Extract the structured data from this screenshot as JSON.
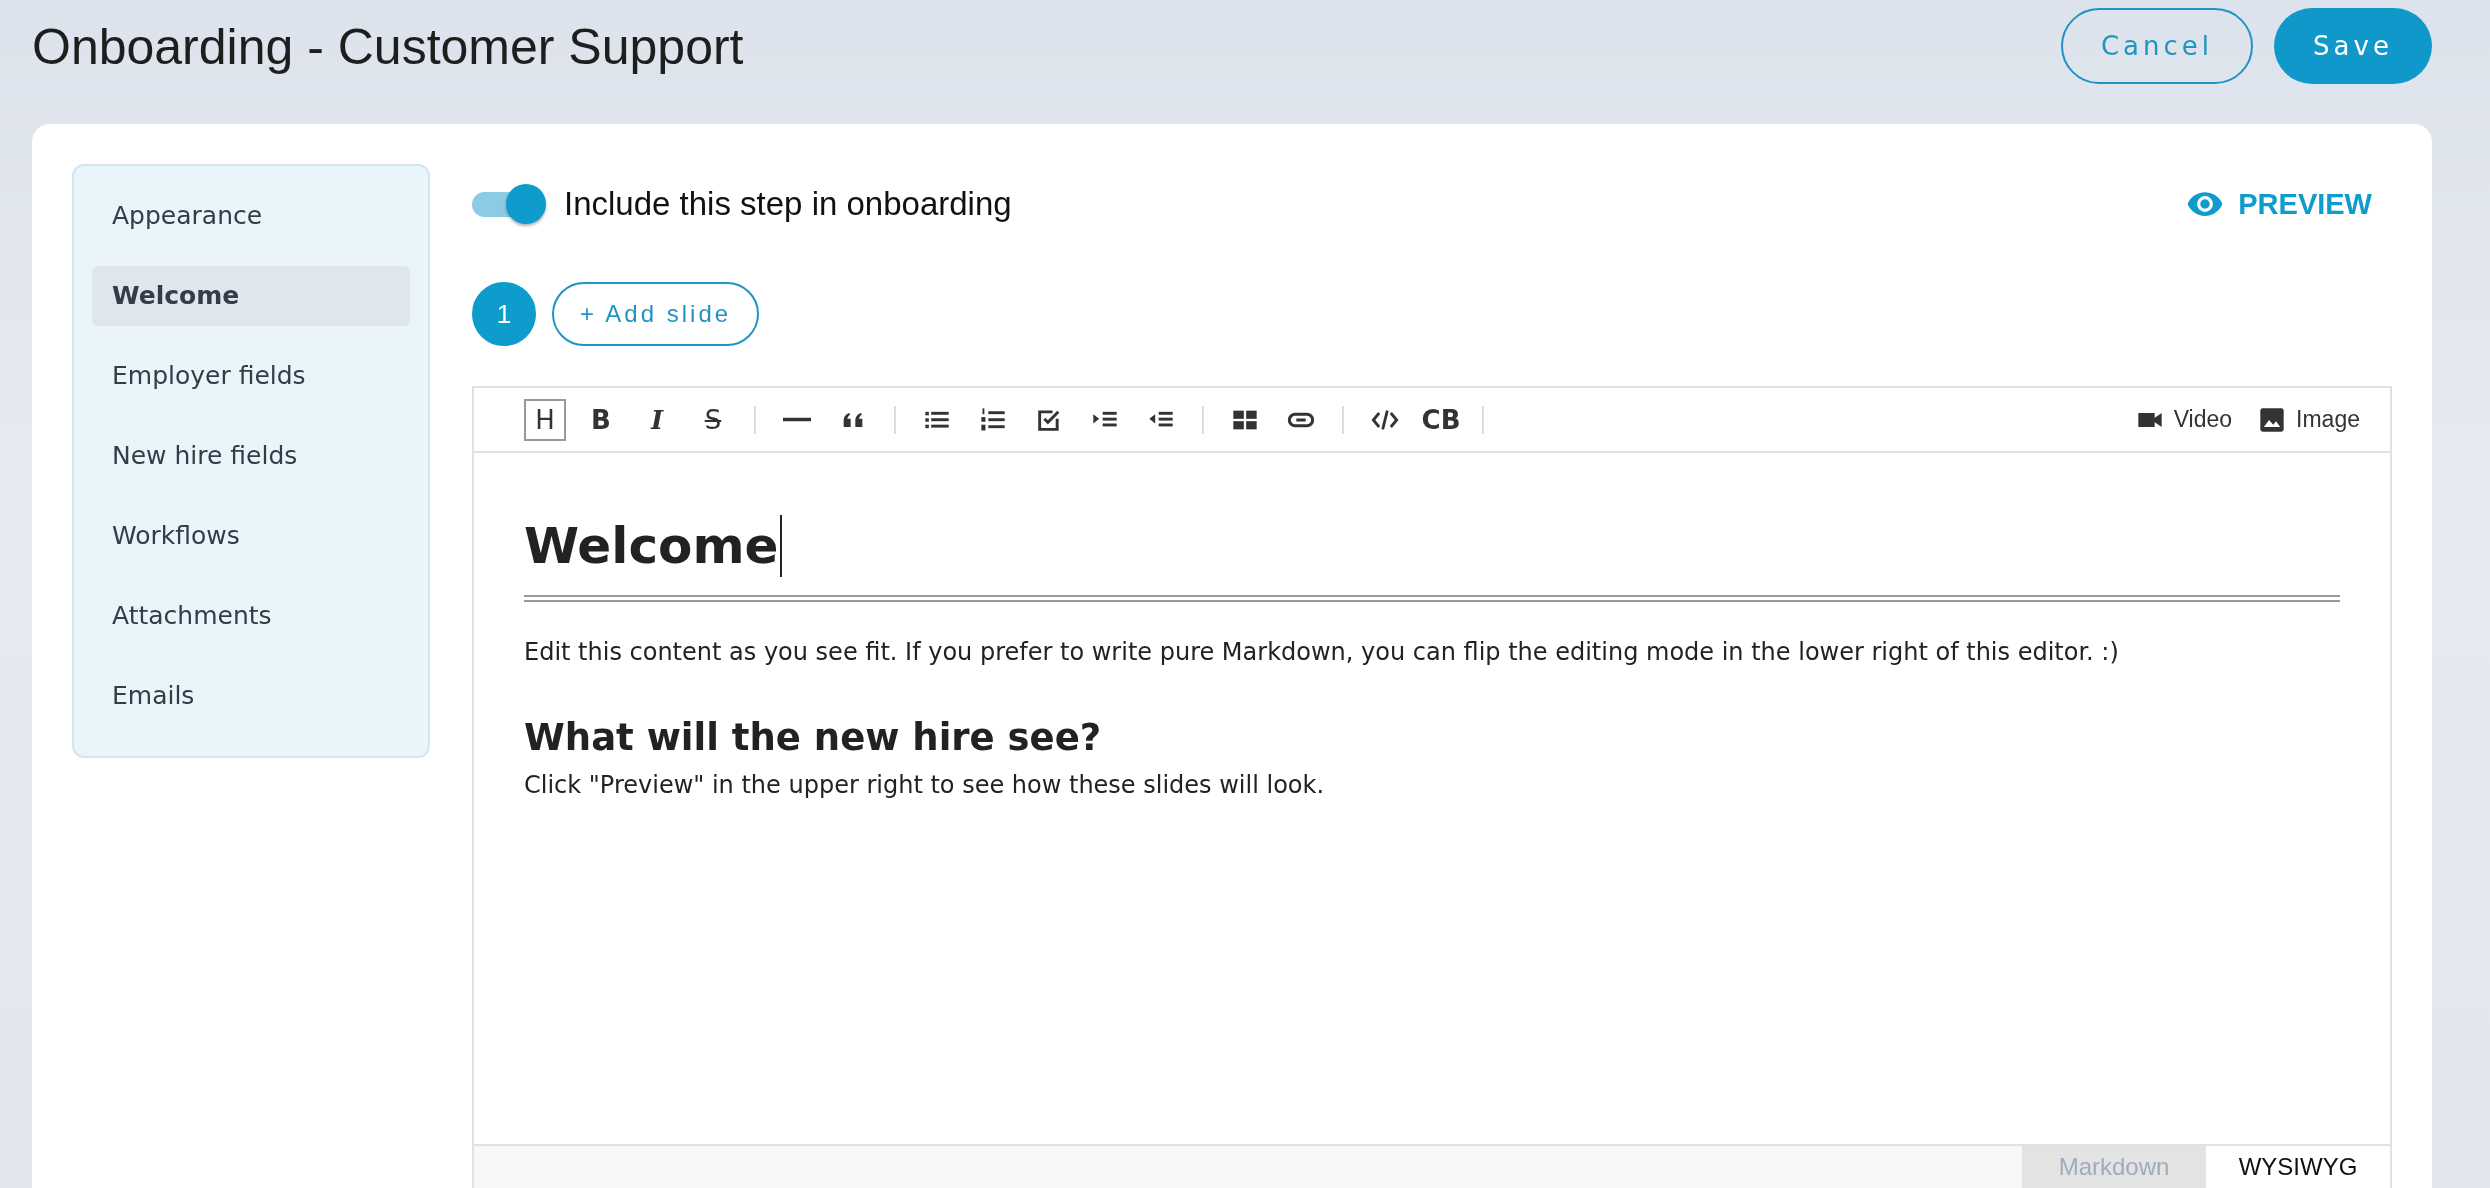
{
  "page": {
    "title": "Onboarding - Customer Support"
  },
  "actions": [
    {
      "label": "Cancel",
      "kind": "outline"
    },
    {
      "label": "Save",
      "kind": "primary"
    }
  ],
  "sidebar": {
    "items": [
      {
        "label": "Appearance",
        "selected": false
      },
      {
        "label": "Welcome",
        "selected": true
      },
      {
        "label": "Employer fields",
        "selected": false
      },
      {
        "label": "New hire fields",
        "selected": false
      },
      {
        "label": "Workflows",
        "selected": false
      },
      {
        "label": "Attachments",
        "selected": false
      },
      {
        "label": "Emails",
        "selected": false
      }
    ]
  },
  "include_toggle": {
    "label": "Include this step in onboarding",
    "on": true
  },
  "preview": {
    "label": "PREVIEW"
  },
  "slides": [
    {
      "label": "1",
      "selected": true
    }
  ],
  "add_slide": {
    "label": "+ Add slide"
  },
  "toolbar": {
    "tools": [
      {
        "kind": "heading",
        "label": "H",
        "selected": true
      },
      {
        "kind": "bold",
        "label": "B",
        "selected": false
      },
      {
        "kind": "italic",
        "label": "I",
        "selected": false
      },
      {
        "kind": "strike",
        "label": "S",
        "selected": false
      },
      {
        "kind": "separator"
      },
      {
        "kind": "rule",
        "selected": false
      },
      {
        "kind": "quote",
        "selected": false
      },
      {
        "kind": "separator"
      },
      {
        "kind": "bullets",
        "selected": false
      },
      {
        "kind": "numbers",
        "selected": false
      },
      {
        "kind": "checklist",
        "selected": false
      },
      {
        "kind": "indent",
        "selected": false
      },
      {
        "kind": "outdent",
        "selected": false
      },
      {
        "kind": "separator"
      },
      {
        "kind": "table",
        "selected": false
      },
      {
        "kind": "link",
        "selected": false
      },
      {
        "kind": "separator"
      },
      {
        "kind": "code",
        "selected": false
      },
      {
        "kind": "codeblock",
        "label": "CB",
        "selected": false
      },
      {
        "kind": "separator"
      }
    ],
    "media": [
      {
        "kind": "video",
        "label": "Video"
      },
      {
        "kind": "image",
        "label": "Image"
      }
    ]
  },
  "content": [
    {
      "kind": "h1",
      "text": "Welcome"
    },
    {
      "kind": "p",
      "text": "Edit this content as you see fit. If you prefer to write pure Markdown, you can flip the editing mode in the lower right of this editor. :)"
    },
    {
      "kind": "h2",
      "text": "What will the new hire see?"
    },
    {
      "kind": "p",
      "text": "Click \"Preview\" in the upper right to see how these slides will look."
    }
  ],
  "modes": [
    {
      "label": "Markdown",
      "selected": false
    },
    {
      "label": "WYSIWYG",
      "selected": true
    }
  ]
}
